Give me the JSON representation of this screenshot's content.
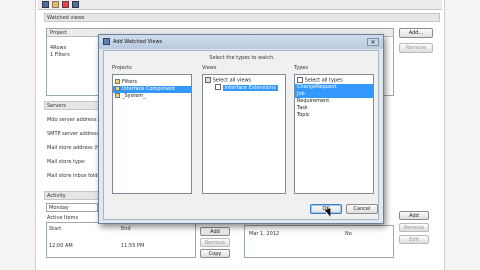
{
  "main": {
    "watched_views": {
      "title": "Watched views",
      "column": "Project",
      "rows": [
        "4Rows",
        "1 Filters"
      ],
      "add": "Add...",
      "remove": "Remove"
    },
    "servers": {
      "title": "Servers",
      "labels": [
        "Mdo server address:",
        "SMTP server address",
        "Mail store address (for",
        "Mail store type:",
        "Mail store inbox folder:"
      ]
    },
    "activity": {
      "title": "Activity",
      "select_value": "Monday",
      "active_items": "Active Items",
      "start_label": "Start",
      "end_label": "End",
      "start_value": "12:00 AM",
      "end_value": "11:55 PM",
      "buttons": [
        "Add",
        "Remove",
        "Copy"
      ],
      "date_value": "Mar 1, 2012",
      "no_value": "No",
      "right_buttons": [
        "Add",
        "Remove",
        "Edit"
      ]
    }
  },
  "dialog": {
    "title": "Add Watched Views",
    "instruction": "Select the types to watch.",
    "projects_label": "Projects",
    "views_label": "Views",
    "types_label": "Types",
    "projects": [
      "Filters",
      "Interface Component",
      "_System_"
    ],
    "select_all_views": "Select all views",
    "views": [
      "Interface Extensions"
    ],
    "select_all_types": "Select all types",
    "types": [
      "ChangeRequest",
      "Job",
      "Requirement",
      "Task",
      "Topic"
    ],
    "ok": "OK",
    "cancel": "Cancel"
  }
}
